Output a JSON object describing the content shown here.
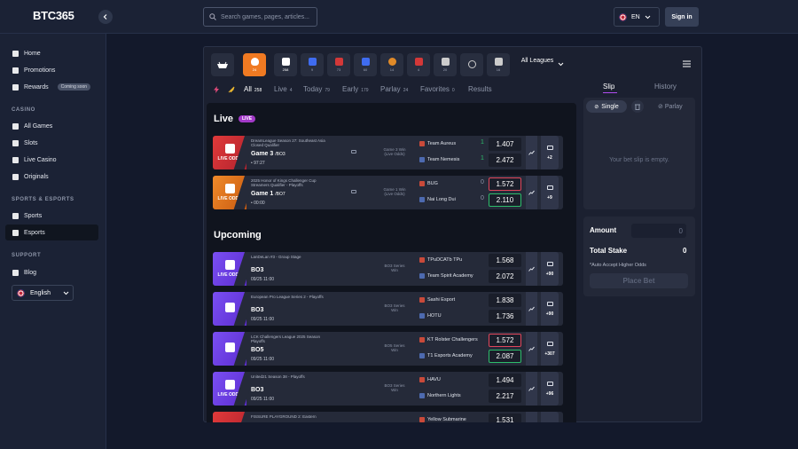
{
  "header": {
    "logo": "BTC365",
    "search_placeholder": "Search games, pages, articles...",
    "language": "EN",
    "signin": "Sign in"
  },
  "sidebar": {
    "items_top": [
      {
        "label": "Home",
        "icon": "home-icon"
      },
      {
        "label": "Promotions",
        "icon": "gift-icon"
      },
      {
        "label": "Rewards",
        "icon": "rewards-icon",
        "badge": "Coming soon"
      }
    ],
    "casino_title": "CASINO",
    "casino": [
      {
        "label": "All Games",
        "icon": "games-icon"
      },
      {
        "label": "Slots",
        "icon": "slots-icon"
      },
      {
        "label": "Live Casino",
        "icon": "live-casino-icon"
      },
      {
        "label": "Originals",
        "icon": "originals-icon"
      }
    ],
    "sports_title": "SPORTS & ESPORTS",
    "sports": [
      {
        "label": "Sports",
        "icon": "sports-icon"
      },
      {
        "label": "Esports",
        "icon": "esports-icon",
        "active": true
      }
    ],
    "support_title": "SUPPORT",
    "support": [
      {
        "label": "Blog",
        "icon": "blog-icon"
      }
    ],
    "language": "English"
  },
  "games_bar": {
    "tiles": [
      {
        "count": "24",
        "color": "#f07a22"
      },
      {
        "count": "258",
        "color": "#ffffff"
      },
      {
        "count": "9",
        "color": "#3f6cf0"
      },
      {
        "count": "73",
        "color": "#d33838"
      },
      {
        "count": "60",
        "color": "#3f6cf0"
      },
      {
        "count": "14",
        "color": "#e08a28"
      },
      {
        "count": "4",
        "color": "#d33838"
      },
      {
        "count": "20",
        "color": "#cccccc"
      },
      {
        "count": "",
        "color": "#cccccc"
      },
      {
        "count": "16",
        "color": "#cccccc"
      }
    ],
    "all_leagues": "All Leagues"
  },
  "tabs": [
    {
      "label": "All",
      "count": "258",
      "active": true
    },
    {
      "label": "Live",
      "count": "4"
    },
    {
      "label": "Today",
      "count": "79"
    },
    {
      "label": "Early",
      "count": "179"
    },
    {
      "label": "Parlay",
      "count": "24"
    },
    {
      "label": "Favorites",
      "count": "0"
    },
    {
      "label": "Results",
      "count": ""
    }
  ],
  "live": {
    "title": "Live",
    "badge": "LIVE",
    "matches": [
      {
        "tag": "LIVE ODDS",
        "color": "red",
        "league": "DreamLeague Season 27: Southeast Asia Closed Qualifier",
        "game": "Game 3",
        "format": "/BO3",
        "time": "• 97:27",
        "market": "Game 3 Win (Live Odds)",
        "team1": "Team Aureus",
        "score1": "1",
        "odd1": "1.407",
        "team2": "Team Nemesis",
        "score2": "1",
        "odd2": "2.472",
        "more": "+2"
      },
      {
        "tag": "LIVE ODDS",
        "color": "org",
        "league": "2025 Honor of Kings Challenger Cup Streamers Qualifier - Playoffs",
        "game": "Game 1",
        "format": "/BO7",
        "time": "• 00:00",
        "market": "Game 1 Win (Live Odds)",
        "team1": "BUG",
        "score1": "0",
        "odd1": "1.572",
        "odd1_state": "dn",
        "team2": "Nai Long Dui",
        "score2": "0",
        "odd2": "2.110",
        "odd2_state": "up",
        "more": "+9"
      }
    ]
  },
  "upcoming": {
    "title": "Upcoming",
    "matches": [
      {
        "tag": "LIVE ODDS",
        "color": "pur",
        "league": "LanDeLan #3 - Group Stage",
        "game": "BO3",
        "time": "09/25 11:00",
        "market": "BO3 Series Win",
        "team1": "TPuDCATb TPu",
        "odd1": "1.568",
        "team2": "Team Spirit Academy",
        "odd2": "2.072",
        "more": "+90"
      },
      {
        "tag": "",
        "color": "pur",
        "league": "European Pro League Series 2 - Playoffs",
        "game": "BO3",
        "time": "09/25 11:00",
        "market": "BO3 Series Win",
        "team1": "Sashi Esport",
        "odd1": "1.838",
        "team2": "HOTU",
        "odd2": "1.736",
        "more": "+90"
      },
      {
        "tag": "",
        "color": "pur",
        "league": "LCK Challengers League 2025 Season Playoffs",
        "game": "BO5",
        "time": "09/25 11:00",
        "market": "BO5 Series Win",
        "team1": "KT Rolster Challengers",
        "odd1": "1.572",
        "odd1_state": "dn",
        "team2": "T1 Esports Academy",
        "odd2": "2.087",
        "odd2_state": "up",
        "more": "+307"
      },
      {
        "tag": "LIVE ODDS",
        "color": "pur",
        "league": "United21 Season 38 - Playoffs",
        "game": "BO3",
        "time": "09/25 11:00",
        "market": "BO3 Series Win",
        "team1": "HAVU",
        "odd1": "1.494",
        "team2": "Northern Lights",
        "odd2": "2.217",
        "more": "+96"
      },
      {
        "tag": "",
        "color": "red",
        "league": "FISSURE PLAYGROUND 2: Eastern",
        "game": "",
        "time": "",
        "market": "",
        "team1": "Yellow Submarine",
        "odd1": "1.531",
        "team2": "",
        "odd2": "",
        "more": ""
      }
    ]
  },
  "slip": {
    "tab_slip": "Slip",
    "tab_history": "History",
    "single": "Single",
    "parlay": "Parlay",
    "empty": "Your bet slip is empty.",
    "amount_label": "Amount",
    "amount_value": "0",
    "stake_label": "Total Stake",
    "stake_value": "0",
    "accept": "*Auto Accept Higher Odds",
    "place": "Place Bet"
  }
}
